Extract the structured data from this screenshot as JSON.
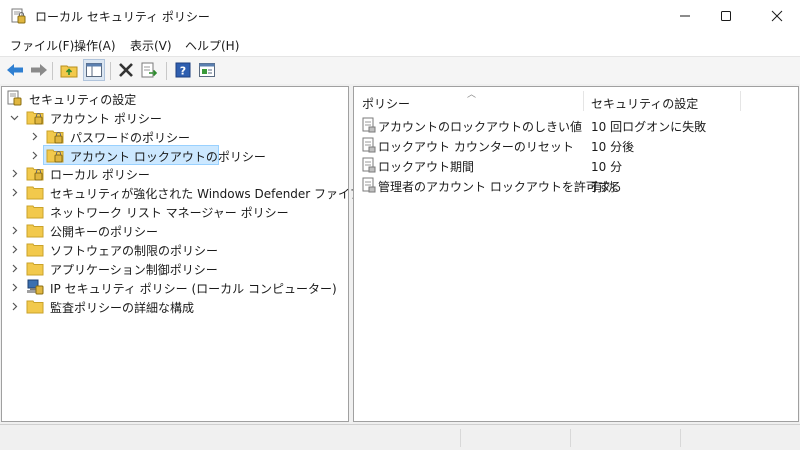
{
  "window": {
    "title": "ローカル セキュリティ ポリシー"
  },
  "menu": {
    "items": [
      "ファイル(F)",
      "操作(A)",
      "表示(V)",
      "ヘルプ(H)"
    ]
  },
  "toolbar": {
    "buttons": [
      "back-arrow-icon",
      "forward-arrow-icon",
      "up-folder-icon",
      "show-hide-tree-icon",
      "delete-icon",
      "export-list-icon",
      "help-icon",
      "properties-icon"
    ]
  },
  "tree": {
    "root": "セキュリティの設定",
    "items": [
      {
        "label": "アカウント ポリシー",
        "level": 1,
        "expanded": true,
        "icon": "folder-lock-icon"
      },
      {
        "label": "パスワードのポリシー",
        "level": 2,
        "expanded": false,
        "icon": "folder-lock-icon"
      },
      {
        "label": "アカウント ロックアウトのポリシー",
        "level": 2,
        "expanded": false,
        "selected": true,
        "icon": "folder-lock-icon"
      },
      {
        "label": "ローカル ポリシー",
        "level": 1,
        "expanded": false,
        "icon": "folder-lock-icon"
      },
      {
        "label": "セキュリティが強化された Windows Defender ファイアウォール",
        "level": 1,
        "expanded": false,
        "icon": "folder-icon"
      },
      {
        "label": "ネットワーク リスト マネージャー ポリシー",
        "level": 1,
        "expanded": false,
        "no_arrow": true,
        "icon": "folder-icon"
      },
      {
        "label": "公開キーのポリシー",
        "level": 1,
        "expanded": false,
        "icon": "folder-icon"
      },
      {
        "label": "ソフトウェアの制限のポリシー",
        "level": 1,
        "expanded": false,
        "icon": "folder-icon"
      },
      {
        "label": "アプリケーション制御ポリシー",
        "level": 1,
        "expanded": false,
        "icon": "folder-icon"
      },
      {
        "label": "IP セキュリティ ポリシー (ローカル コンピューター)",
        "level": 1,
        "expanded": false,
        "icon": "ip-security-icon"
      },
      {
        "label": "監査ポリシーの詳細な構成",
        "level": 1,
        "expanded": false,
        "icon": "folder-icon"
      }
    ]
  },
  "list": {
    "columns": [
      "ポリシー",
      "セキュリティの設定"
    ],
    "rows": [
      {
        "name": "アカウントのロックアウトのしきい値",
        "value": "10 回ログオンに失敗"
      },
      {
        "name": "ロックアウト カウンターのリセット",
        "value": "10 分後"
      },
      {
        "name": "ロックアウト期間",
        "value": "10 分"
      },
      {
        "name": "管理者のアカウント ロックアウトを許可する",
        "value": "有効"
      }
    ]
  },
  "colors": {
    "selection_bg": "#cce8ff",
    "selection_border": "#99d1ff",
    "folder": "#f2c94c"
  }
}
